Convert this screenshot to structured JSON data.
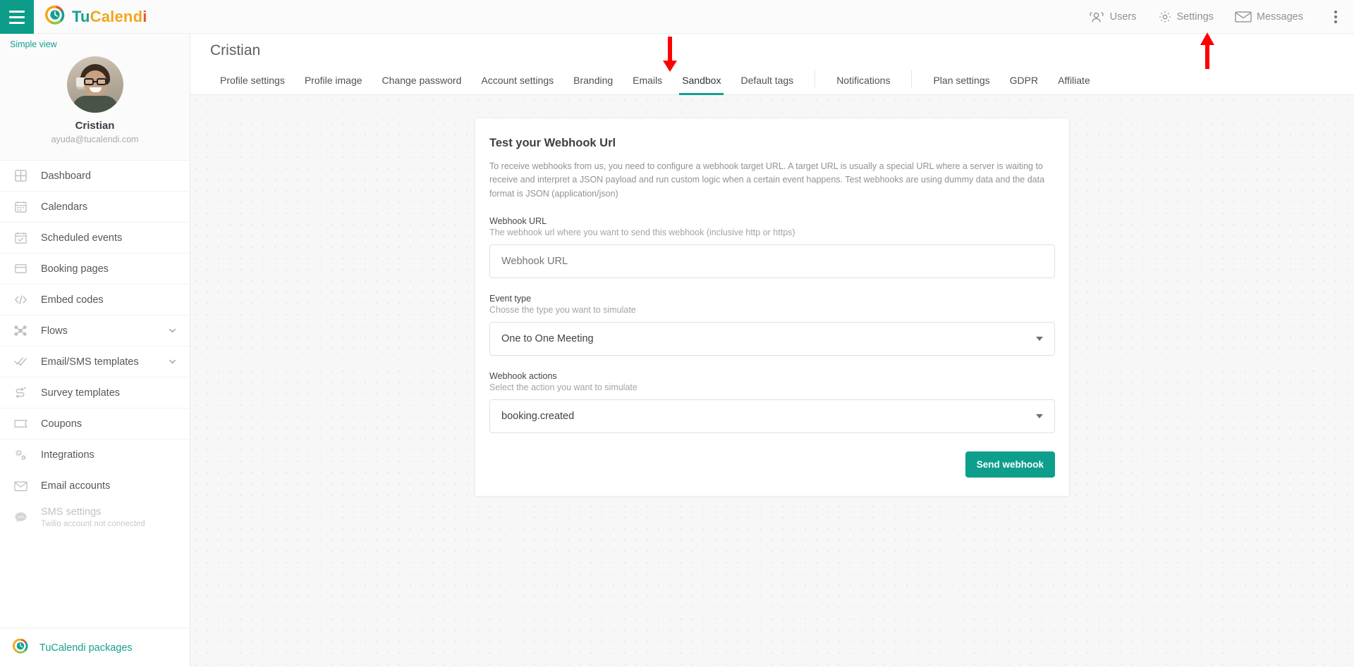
{
  "brand": {
    "part1": "Tu",
    "part2": "Calend",
    "part3": "i"
  },
  "topnav": {
    "users": "Users",
    "settings": "Settings",
    "messages": "Messages"
  },
  "sidebar": {
    "simple_view": "Simple view",
    "profile": {
      "name": "Cristian",
      "email": "ayuda@tucalendi.com"
    },
    "items": [
      {
        "label": "Dashboard",
        "icon": "dashboard-icon",
        "chevron": false,
        "disabled": false,
        "sub": ""
      },
      {
        "label": "Calendars",
        "icon": "calendar-icon",
        "chevron": false,
        "disabled": false,
        "sub": ""
      },
      {
        "label": "Scheduled events",
        "icon": "calendar-check-icon",
        "chevron": false,
        "disabled": false,
        "sub": ""
      },
      {
        "label": "Booking pages",
        "icon": "window-icon",
        "chevron": false,
        "disabled": false,
        "sub": ""
      },
      {
        "label": "Embed codes",
        "icon": "code-icon",
        "chevron": false,
        "disabled": false,
        "sub": ""
      },
      {
        "label": "Flows",
        "icon": "flow-nodes-icon",
        "chevron": true,
        "disabled": false,
        "sub": ""
      },
      {
        "label": "Email/SMS templates",
        "icon": "double-check-icon",
        "chevron": true,
        "disabled": false,
        "sub": ""
      },
      {
        "label": "Survey templates",
        "icon": "survey-arrows-icon",
        "chevron": false,
        "disabled": false,
        "sub": ""
      },
      {
        "label": "Coupons",
        "icon": "ticket-icon",
        "chevron": false,
        "disabled": false,
        "sub": ""
      },
      {
        "label": "Integrations",
        "icon": "gears-icon",
        "chevron": false,
        "disabled": false,
        "sub": ""
      },
      {
        "label": "Email accounts",
        "icon": "envelope-icon",
        "chevron": false,
        "disabled": false,
        "sub": ""
      },
      {
        "label": "SMS settings",
        "icon": "sms-bubble-icon",
        "chevron": false,
        "disabled": true,
        "sub": "Twilio account not connected"
      }
    ],
    "footer": {
      "label": "TuCalendi packages"
    }
  },
  "main": {
    "page_title": "Cristian",
    "tabs": [
      {
        "label": "Profile settings",
        "active": false,
        "divider_after": false
      },
      {
        "label": "Profile image",
        "active": false,
        "divider_after": false
      },
      {
        "label": "Change password",
        "active": false,
        "divider_after": false
      },
      {
        "label": "Account settings",
        "active": false,
        "divider_after": false
      },
      {
        "label": "Branding",
        "active": false,
        "divider_after": false
      },
      {
        "label": "Emails",
        "active": false,
        "divider_after": false
      },
      {
        "label": "Sandbox",
        "active": true,
        "divider_after": false
      },
      {
        "label": "Default tags",
        "active": false,
        "divider_after": true
      },
      {
        "label": "Notifications",
        "active": false,
        "divider_after": true
      },
      {
        "label": "Plan settings",
        "active": false,
        "divider_after": false
      },
      {
        "label": "GDPR",
        "active": false,
        "divider_after": false
      },
      {
        "label": "Affiliate",
        "active": false,
        "divider_after": false
      }
    ]
  },
  "card": {
    "title": "Test your Webhook Url",
    "description": "To receive webhooks from us, you need to configure a webhook target URL. A target URL is usually a special URL where a server is waiting to receive and interpret a JSON payload and run custom logic when a certain event happens. Test webhooks are using dummy data and the data format is JSON (application/json)",
    "webhook_url": {
      "label": "Webhook URL",
      "help": "The webhook url where you want to send this webhook (inclusive http or https)",
      "placeholder": "Webhook URL",
      "value": ""
    },
    "event_type": {
      "label": "Event type",
      "help": "Chosse the type you want to simulate",
      "value": "One to One Meeting"
    },
    "webhook_actions": {
      "label": "Webhook actions",
      "help": "Select the action you want to simulate",
      "value": "booking.created"
    },
    "submit_label": "Send webhook"
  },
  "annotations": {
    "arrow_color": "#ff0000",
    "arrow_tab_target": "Sandbox",
    "arrow_settings_target": "Settings"
  },
  "colors": {
    "accent_teal": "#0d9e8c",
    "brand_orange": "#e8552d",
    "brand_yellow": "#f2a71b",
    "content_bg": "#f7f7f7"
  }
}
